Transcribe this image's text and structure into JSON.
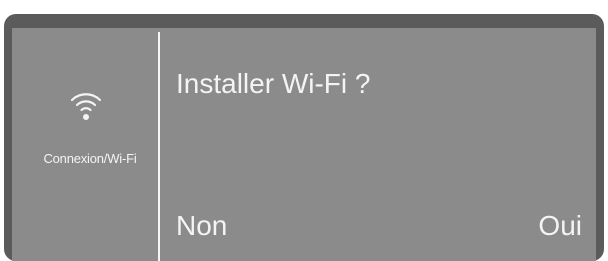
{
  "sidebar": {
    "icon": "wifi-icon",
    "label": "Connexion/Wi-Fi"
  },
  "main": {
    "prompt": "Installer Wi-Fi ?",
    "no_label": "Non",
    "yes_label": "Oui"
  },
  "colors": {
    "bezel": "#5b5b5b",
    "screen": "#8b8b8b",
    "text": "#f4f4f4"
  }
}
